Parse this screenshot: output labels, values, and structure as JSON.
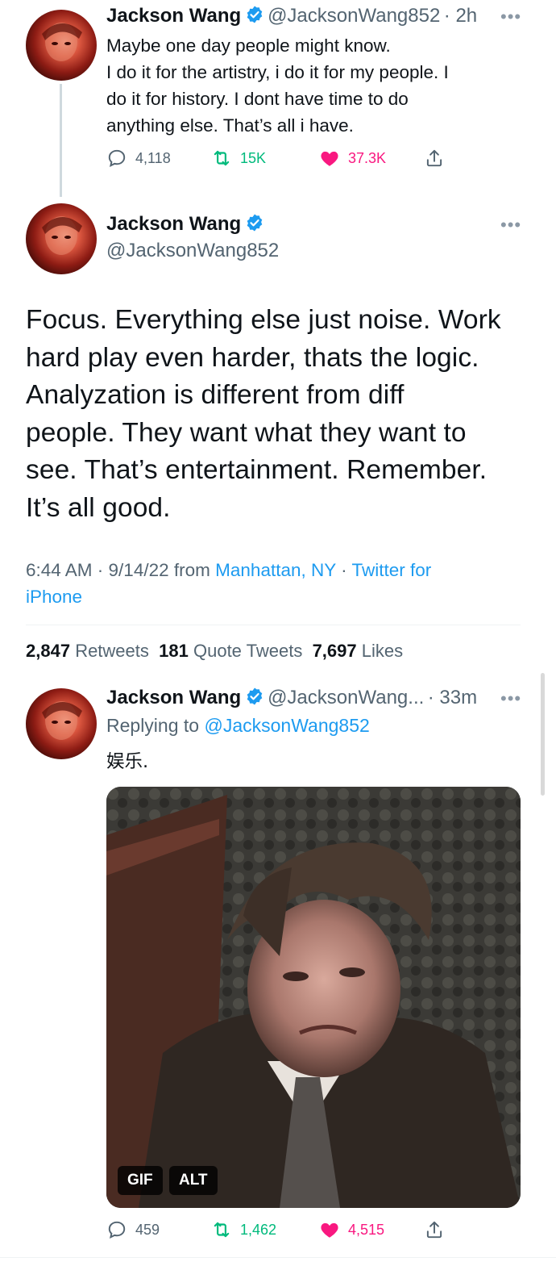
{
  "tweet1": {
    "name": "Jackson Wang",
    "handle": "@JacksonWang852",
    "time": "· 2h",
    "lines": [
      "Maybe one day people might know.",
      "I do it for the artistry, i do it for my people. I",
      "do it for history. I dont have time to do",
      "anything else. That’s all i have."
    ],
    "replies": "4,118",
    "retweets": "15K",
    "likes": "37.3K"
  },
  "main_tweet": {
    "name": "Jackson Wang",
    "handle": "@JacksonWang852",
    "lines": [
      "Focus. Everything else just noise. Work",
      "hard play even harder, thats the logic.",
      "Analyzation is different from diff",
      "people. They want what they want to",
      "see. That’s entertainment. Remember.",
      "It’s all good."
    ],
    "timestamp": "6:44 AM · 9/14/22",
    "from_word": "from",
    "location": "Manhattan, NY",
    "source_sep": "·",
    "source_line1": "Twitter for",
    "source_line2": "iPhone",
    "stats": {
      "retweets_count": "2,847",
      "retweets_label": "Retweets",
      "quotes_count": "181",
      "quotes_label": "Quote Tweets",
      "likes_count": "7,697",
      "likes_label": "Likes"
    }
  },
  "reply": {
    "name": "Jackson Wang",
    "handle": "@JacksonWang...",
    "time": "· 33m",
    "replying_to_label": "Replying to",
    "replying_to_handle": "@JacksonWang852",
    "text": "娱乐.",
    "media_badges": {
      "gif": "GIF",
      "alt": "ALT"
    },
    "replies": "459",
    "retweets": "1,462",
    "likes": "4,515"
  },
  "icons": {
    "verified": "verified-badge-icon",
    "more": "more-dots-icon",
    "reply": "reply-bubble-icon",
    "retweet": "retweet-icon",
    "like": "heart-icon",
    "share": "share-icon"
  },
  "colors": {
    "accent_blue": "#1d9bf0",
    "retweet_green": "#00ba7c",
    "like_pink": "#f91880",
    "muted": "#536471"
  }
}
